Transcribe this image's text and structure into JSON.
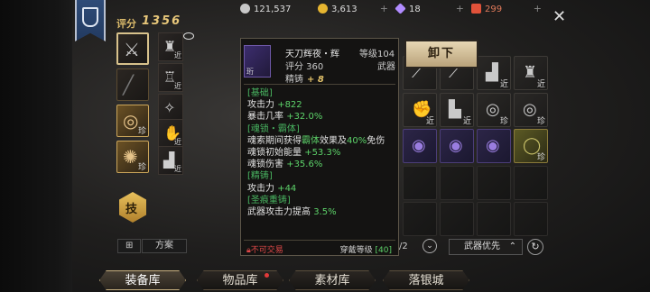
{
  "header": {
    "score_label": "评分",
    "score_value": "1356",
    "currencies": [
      {
        "name": "silver",
        "value": "121,537",
        "color": "#c8c8c8"
      },
      {
        "name": "gold",
        "value": "3,613",
        "color": "#e6b530"
      },
      {
        "name": "gem",
        "value": "18",
        "color": "#b18cff"
      },
      {
        "name": "ticket",
        "value": "299",
        "color": "#e0523a"
      }
    ],
    "plus": "+",
    "close": "✕"
  },
  "equip": {
    "slot_tag_near": "近",
    "slot_tag_ring": "珍",
    "skill_label": "技",
    "grid_icon": "⊞",
    "scheme_label": "方案"
  },
  "tooltip": {
    "name": "天刀辉夜・辉",
    "icon_tag": "珩",
    "level": "等级104",
    "score": "评分 360",
    "type": "武器",
    "refine_label": "精铸",
    "refine_value": "+ 8",
    "lines": [
      {
        "text": "[基础]",
        "style": "sec"
      },
      {
        "parts": [
          {
            "t": "攻击力 ",
            "c": "txt"
          },
          {
            "t": "+822",
            "c": "grn"
          }
        ]
      },
      {
        "parts": [
          {
            "t": "暴击几率 ",
            "c": "txt"
          },
          {
            "t": "+32.0%",
            "c": "grn"
          }
        ]
      },
      {
        "text": "[魂锁・霸体]",
        "style": "sec"
      },
      {
        "parts": [
          {
            "t": "魂索期间获得",
            "c": "txt"
          },
          {
            "t": "霸体",
            "c": "grn"
          },
          {
            "t": "效果及",
            "c": "txt"
          },
          {
            "t": "40%",
            "c": "grn"
          },
          {
            "t": "免伤",
            "c": "txt"
          }
        ]
      },
      {
        "parts": [
          {
            "t": "魂锁初始能量 ",
            "c": "txt"
          },
          {
            "t": "+53.3%",
            "c": "grn"
          }
        ]
      },
      {
        "parts": [
          {
            "t": "魂锁伤害 ",
            "c": "txt"
          },
          {
            "t": "+35.6%",
            "c": "grn"
          }
        ]
      },
      {
        "text": "[精铸]",
        "style": "sec"
      },
      {
        "parts": [
          {
            "t": "攻击力 ",
            "c": "txt"
          },
          {
            "t": "+44",
            "c": "grn"
          }
        ]
      },
      {
        "text": "[圣痕重铸]",
        "style": "sec"
      },
      {
        "parts": [
          {
            "t": "武器攻击力提高 ",
            "c": "txt"
          },
          {
            "t": "3.5%",
            "c": "grn"
          }
        ]
      }
    ],
    "untradable": "不可交易",
    "wear_label": "穿戴等级",
    "wear_value": "[40]"
  },
  "unload_label": "卸下",
  "inventory": {
    "page": "/2",
    "down": "⌄",
    "sort_label": "武器优先",
    "sort_caret": "⌃",
    "refresh": "↻",
    "tag_near": "近",
    "tag_ring": "珍"
  },
  "tabs": [
    {
      "label": "装备库",
      "active": true
    },
    {
      "label": "物品库",
      "active": false
    },
    {
      "label": "素材库",
      "active": false
    },
    {
      "label": "落银城",
      "active": false
    }
  ]
}
